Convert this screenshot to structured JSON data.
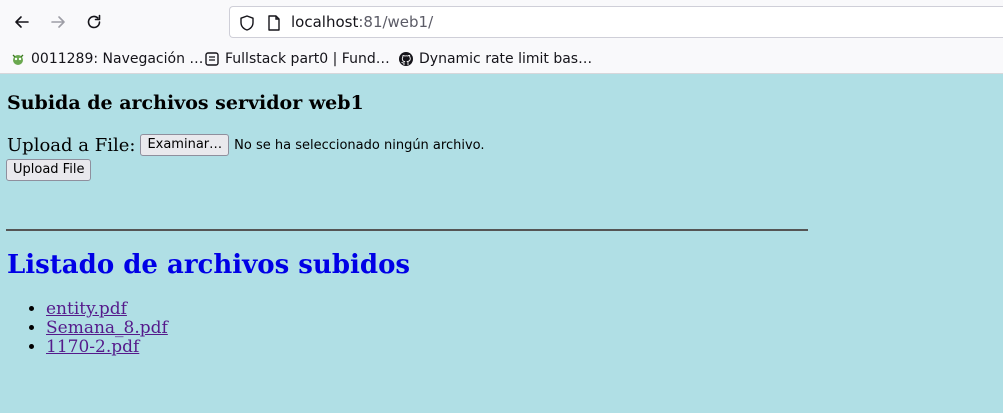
{
  "browser": {
    "url_host": "localhost",
    "url_rest": ":81/web1/",
    "bookmarks": [
      {
        "label": "0011289: Navegación …",
        "icon": "bug-icon"
      },
      {
        "label": "Fullstack part0 | Fund…",
        "icon": "page-icon"
      },
      {
        "label": "Dynamic rate limit bas…",
        "icon": "github-icon"
      }
    ]
  },
  "page": {
    "title": "Subida de archivos servidor web1",
    "upload_label": "Upload a File:",
    "browse_button": "Examinar…",
    "no_file_text": "No se ha seleccionado ningún archivo.",
    "upload_button": "Upload File",
    "list_title": "Listado de archivos subidos",
    "files": [
      "entity.pdf",
      "Semana_8.pdf",
      "1170-2.pdf"
    ]
  },
  "colors": {
    "background": "#b0dfe5",
    "list_title": "#0000e6",
    "link_visited": "#551a8b"
  }
}
